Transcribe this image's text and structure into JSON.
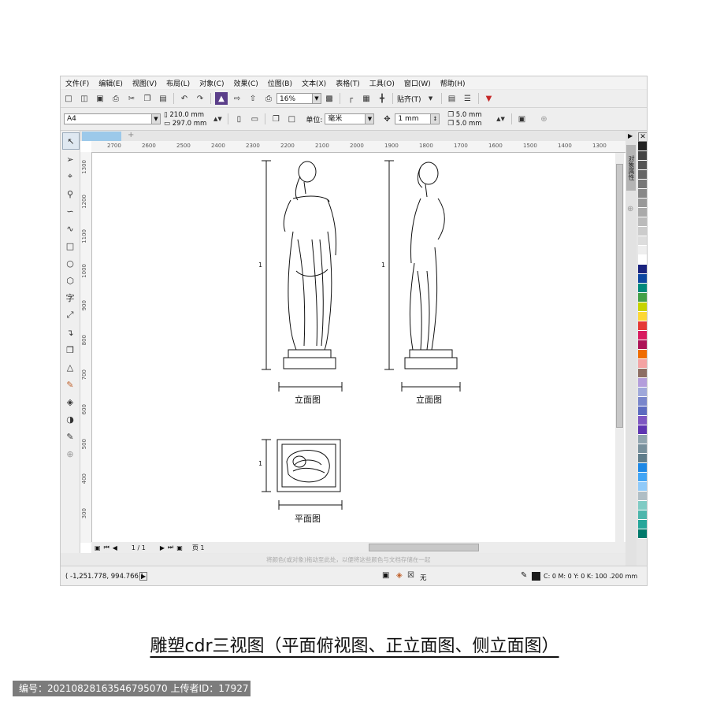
{
  "menu": [
    "文件(F)",
    "编辑(E)",
    "视图(V)",
    "布局(L)",
    "对象(C)",
    "效果(C)",
    "位图(B)",
    "文本(X)",
    "表格(T)",
    "工具(O)",
    "窗口(W)",
    "帮助(H)"
  ],
  "toolbar": {
    "zoom": "16%",
    "snap_label": "贴齐(T)"
  },
  "propbar": {
    "page_size": "A4",
    "width": "210.0 mm",
    "height": "297.0 mm",
    "unit_label": "单位:",
    "unit_value": "毫米",
    "nudge": "1 mm",
    "dup_x": "5.0 mm",
    "dup_y": "5.0 mm"
  },
  "ruler": {
    "h_ticks": [
      "2700",
      "2600",
      "2500",
      "2400",
      "2300",
      "2200",
      "2100",
      "2000",
      "1900",
      "1800",
      "1700",
      "1600",
      "1500",
      "1400",
      "1300"
    ],
    "v_ticks": [
      "1300",
      "1200",
      "1100",
      "1000",
      "900",
      "800",
      "700",
      "600",
      "500",
      "400",
      "300"
    ]
  },
  "drawing": {
    "front_label": "立面图",
    "side_label": "立面图",
    "plan_label": "平面图",
    "dim_mark": "1"
  },
  "pagebar": {
    "page_count": "1 / 1",
    "page_tab": "页 1"
  },
  "hint": "将颜色(或对象)拖动至此处，以便将这些颜色与文档存储在一起",
  "status": {
    "coords": "( -1,251.778, 994.766 )",
    "fill_none": "无",
    "color_info": "C: 0 M: 0 Y: 0 K: 100  .200 mm"
  },
  "dock": {
    "tab_label": "对象属性"
  },
  "palette": [
    "#222222",
    "#444444",
    "#555555",
    "#666666",
    "#777777",
    "#888888",
    "#999999",
    "#aaaaaa",
    "#bbbbbb",
    "#cccccc",
    "#dddddd",
    "#eeeeee",
    "#ffffff",
    "#1a237e",
    "#0d47a1",
    "#00897b",
    "#43a047",
    "#c6d300",
    "#fdd835",
    "#e53935",
    "#d81b60",
    "#ad1457",
    "#ef6c00",
    "#f4a3a3",
    "#8d6e63",
    "#b39ddb",
    "#9fa8da",
    "#7986cb",
    "#5c6bc0",
    "#7e57c2",
    "#5e35b1",
    "#90a4ae",
    "#78909c",
    "#607d8b",
    "#1e88e5",
    "#42a5f5",
    "#90caf9",
    "#b0bec5",
    "#80cbc4",
    "#4db6ac",
    "#26a69a",
    "#00796b"
  ],
  "caption": "雕塑cdr三视图（平面俯视图、正立面图、侧立面图）",
  "footer": "编号：20210828163546795070 上传者ID：17927"
}
